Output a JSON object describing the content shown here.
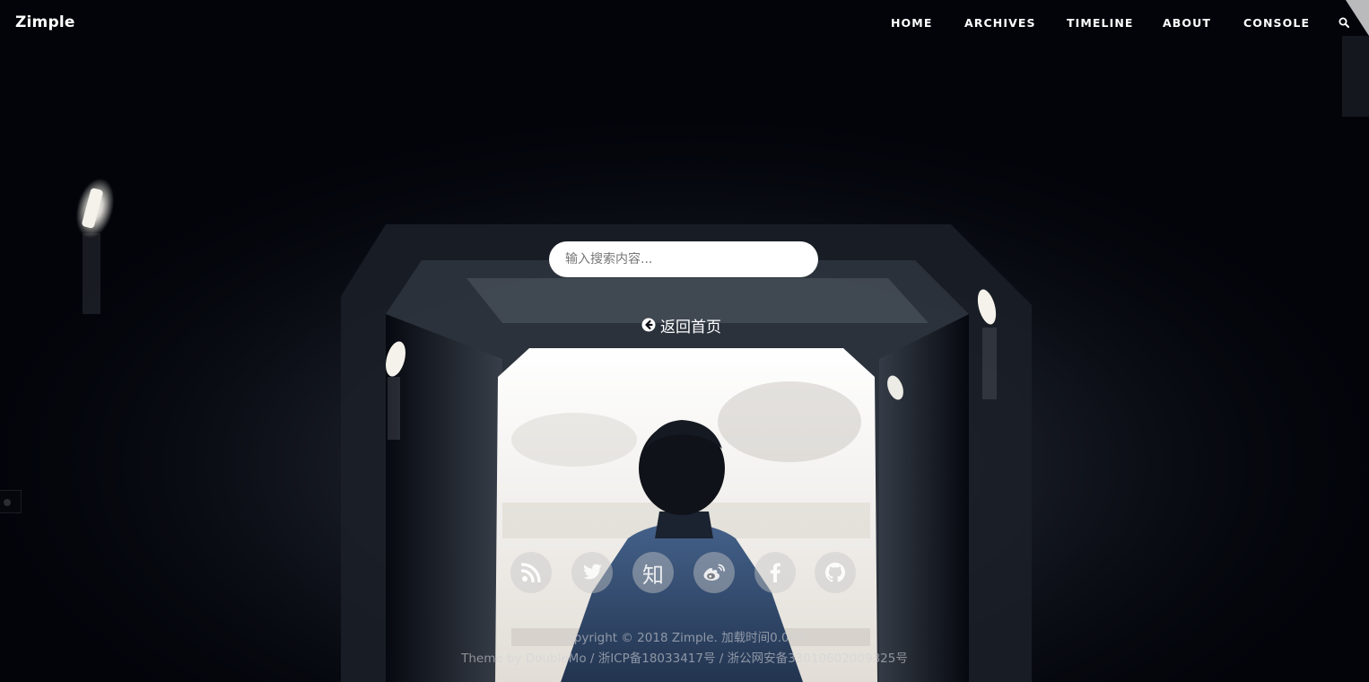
{
  "brand": {
    "name": "Zimple"
  },
  "nav": {
    "items": [
      {
        "label": "HOME"
      },
      {
        "label": "ARCHIVES"
      },
      {
        "label": "TIMELINE"
      },
      {
        "label": "ABOUT"
      },
      {
        "label": "CONSOLE"
      }
    ],
    "search_icon": "search-icon"
  },
  "search": {
    "placeholder": "输入搜索内容..."
  },
  "back_home": {
    "label": "返回首页",
    "icon": "arrow-circle-left-icon"
  },
  "social": [
    {
      "name": "rss",
      "icon": "rss-icon"
    },
    {
      "name": "twitter",
      "icon": "twitter-icon"
    },
    {
      "name": "zhihu",
      "icon": "zhihu-icon",
      "glyph": "知"
    },
    {
      "name": "weibo",
      "icon": "weibo-icon"
    },
    {
      "name": "facebook",
      "icon": "facebook-icon"
    },
    {
      "name": "github",
      "icon": "github-icon"
    }
  ],
  "footer": {
    "copyright": "Copyright © 2018 Zimple. 加载时间0.004s",
    "theme_line": "Theme by DoubleMo / 浙ICP备18033417号 / 浙公网安备33010602009325号"
  },
  "colors": {
    "background": "#02040a",
    "nav_text": "#ffffff",
    "social_bg": "#c8c8c8"
  }
}
